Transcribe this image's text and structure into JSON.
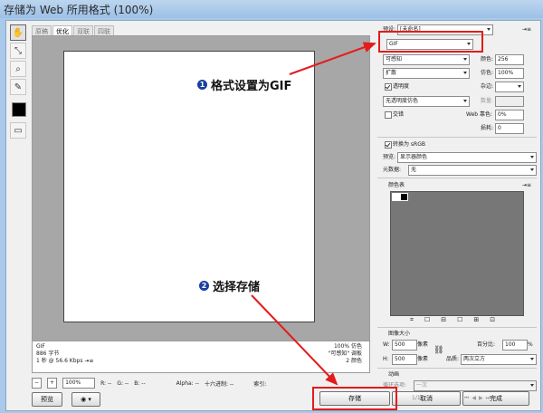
{
  "window": {
    "title": "存储为 Web 所用格式 (100%)"
  },
  "tabs": [
    "原稿",
    "优化",
    "双联",
    "四联"
  ],
  "info_left": [
    "GIF",
    "886 字节",
    "1 秒 @ 56.6 Kbps  ⇥≡"
  ],
  "info_right": [
    "100% 仿色",
    "\"可感知\" 调板",
    "2 颜色"
  ],
  "status": {
    "zoom": "100%",
    "r": "R:  --",
    "g": "G:  --",
    "b": "B:  --",
    "alpha": "Alpha:  --",
    "hex": "十六进制:  --",
    "index": "索引:"
  },
  "buttons": {
    "preview": "预览",
    "save": "存储",
    "cancel": "取消",
    "done": "完成"
  },
  "right": {
    "preset_label": "预设:",
    "preset_value": "[未命名]",
    "format_value": "GIF",
    "reduction": "可感知",
    "colors_label": "颜色:",
    "colors_value": "256",
    "dither_algo": "扩散",
    "dither_label": "仿色:",
    "dither_value": "100%",
    "transparency_label": "透明度",
    "matte_label": "杂边:",
    "trans_dither": "无透明度仿色",
    "amount_label": "数量:",
    "interlaced_label": "交错",
    "websnap_label": "Web 靠色:",
    "websnap_value": "0%",
    "lossy_label": "损耗:",
    "lossy_value": "0",
    "convert_srgb": "转换为 sRGB",
    "preview_label": "预览:",
    "preview_value": "显示器颜色",
    "metadata_label": "元数据:",
    "metadata_value": "无",
    "colortable_label": "颜色表",
    "image_size_label": "图像大小",
    "w_label": "W:",
    "w_value": "500",
    "h_label": "H:",
    "h_value": "500",
    "px": "像素",
    "percent_label": "百分比:",
    "percent_value": "100",
    "pct": "%",
    "quality_label": "品质:",
    "quality_value": "两次立方",
    "animation_label": "动画",
    "loop_label": "循环选项:",
    "loop_value": "一次",
    "frame_counter": "1/1"
  },
  "annotations": {
    "a1_num": "1",
    "a1_text": "格式设置为GIF",
    "a2_num": "2",
    "a2_text": "选择存储"
  },
  "colors": {
    "accent_red": "#e31b1b",
    "badge_blue": "#1a3fa0"
  }
}
